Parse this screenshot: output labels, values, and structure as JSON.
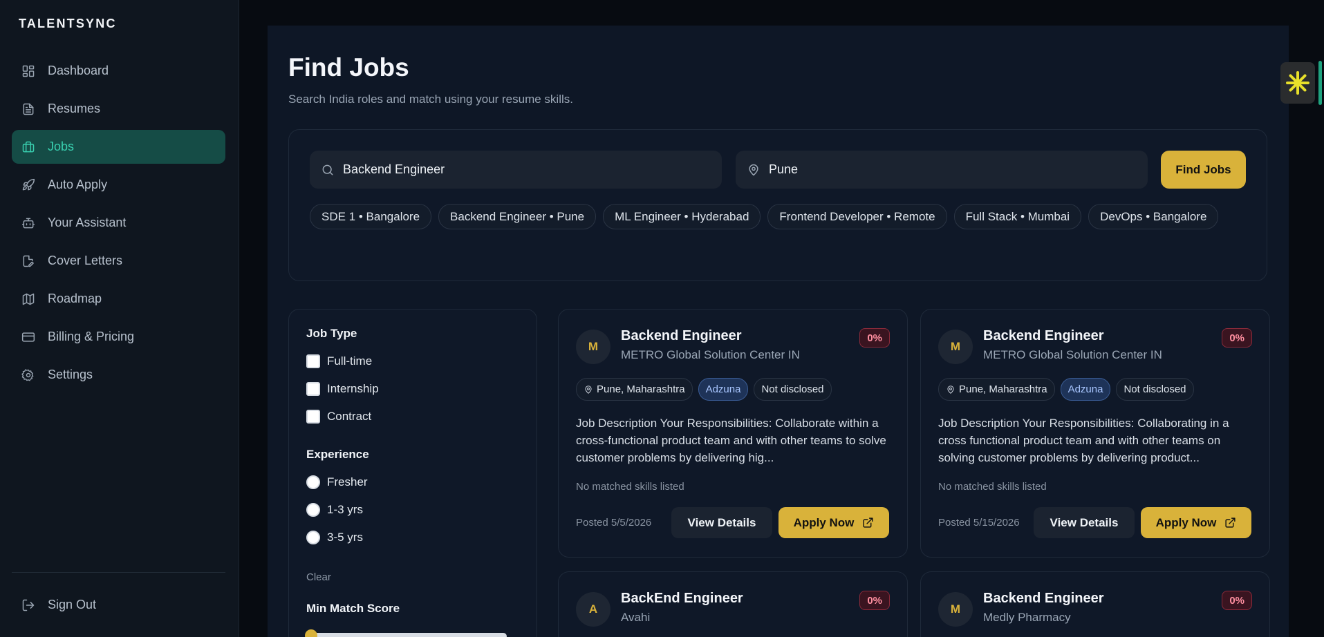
{
  "brand": "TALENTSYNC",
  "nav": [
    {
      "label": "Dashboard",
      "icon": "dashboard-icon"
    },
    {
      "label": "Resumes",
      "icon": "document-icon"
    },
    {
      "label": "Jobs",
      "icon": "briefcase-icon",
      "active": true
    },
    {
      "label": "Auto Apply",
      "icon": "rocket-icon"
    },
    {
      "label": "Your Assistant",
      "icon": "robot-icon"
    },
    {
      "label": "Cover Letters",
      "icon": "file-edit-icon"
    },
    {
      "label": "Roadmap",
      "icon": "map-icon"
    },
    {
      "label": "Billing & Pricing",
      "icon": "credit-card-icon"
    },
    {
      "label": "Settings",
      "icon": "gear-icon"
    }
  ],
  "signout": "Sign Out",
  "page": {
    "title": "Find Jobs",
    "subtitle": "Search India roles and match using your resume skills."
  },
  "search": {
    "query": "Backend Engineer",
    "location": "Pune",
    "button": "Find Jobs",
    "chips": [
      "SDE 1 • Bangalore",
      "Backend Engineer • Pune",
      "ML Engineer • Hyderabad",
      "Frontend Developer • Remote",
      "Full Stack • Mumbai",
      "DevOps • Bangalore"
    ]
  },
  "filters": {
    "job_type_heading": "Job Type",
    "job_types": [
      "Full-time",
      "Internship",
      "Contract"
    ],
    "experience_heading": "Experience",
    "experience": [
      "Fresher",
      "1-3 yrs",
      "3-5 yrs"
    ],
    "clear": "Clear",
    "min_match_heading": "Min Match Score"
  },
  "jobs": [
    {
      "initial": "M",
      "title": "Backend Engineer",
      "company": "METRO Global Solution Center IN",
      "score": "0%",
      "location": "Pune, Maharashtra",
      "source": "Adzuna",
      "salary": "Not disclosed",
      "description": "Job Description Your Responsibilities: Collaborate within a cross-functional product team and with other teams to solve customer problems by delivering hig...",
      "skills": "No matched skills listed",
      "posted": "Posted 5/5/2026",
      "view": "View Details",
      "apply": "Apply Now"
    },
    {
      "initial": "M",
      "title": "Backend Engineer",
      "company": "METRO Global Solution Center IN",
      "score": "0%",
      "location": "Pune, Maharashtra",
      "source": "Adzuna",
      "salary": "Not disclosed",
      "description": "Job Description Your Responsibilities: Collaborating in a cross functional product team and with other teams on solving customer problems by delivering product...",
      "skills": "No matched skills listed",
      "posted": "Posted 5/15/2026",
      "view": "View Details",
      "apply": "Apply Now"
    },
    {
      "initial": "A",
      "title": "BackEnd Engineer",
      "company": "Avahi",
      "score": "0%"
    },
    {
      "initial": "M",
      "title": "Backend Engineer",
      "company": "Medly Pharmacy",
      "score": "0%"
    }
  ]
}
